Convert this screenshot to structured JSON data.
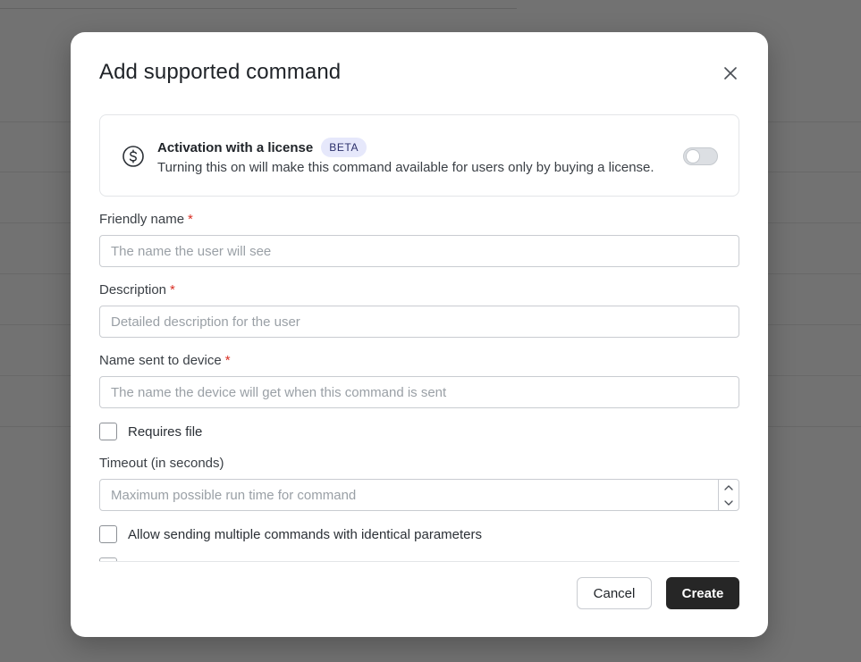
{
  "modal": {
    "title": "Add supported command",
    "close_icon": "close-icon"
  },
  "license": {
    "icon": "dollar-circle-icon",
    "title": "Activation with a license",
    "badge": "BETA",
    "description": "Turning this on will make this command available for users only by buying a license.",
    "toggle_on": false
  },
  "fields": {
    "friendly_name": {
      "label": "Friendly name",
      "required_mark": "*",
      "value": "",
      "placeholder": "The name the user will see"
    },
    "description": {
      "label": "Description",
      "required_mark": "*",
      "value": "",
      "placeholder": "Detailed description for the user"
    },
    "device_name": {
      "label": "Name sent to device",
      "required_mark": "*",
      "value": "",
      "placeholder": "The name the device will get when this command is sent"
    },
    "requires_file": {
      "label": "Requires file",
      "checked": false
    },
    "timeout": {
      "label": "Timeout (in seconds)",
      "value": "",
      "placeholder": "Maximum possible run time for command",
      "increment_icon": "chevron-up-icon",
      "decrement_icon": "chevron-down-icon"
    },
    "allow_multiple": {
      "label": "Allow sending multiple commands with identical parameters",
      "checked": false
    }
  },
  "footer": {
    "cancel_label": "Cancel",
    "create_label": "Create"
  },
  "colors": {
    "primary_button": "#262626",
    "required": "#d93025",
    "badge_bg": "#e6e8fb",
    "overlay": "rgba(0,0,0,0.55)"
  }
}
